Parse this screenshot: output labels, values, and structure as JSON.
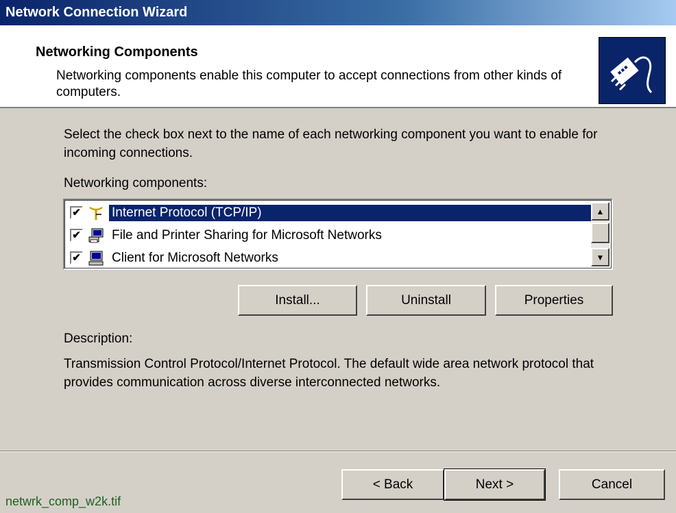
{
  "window": {
    "title": "Network Connection Wizard"
  },
  "header": {
    "title": "Networking Components",
    "subtitle": "Networking components enable this computer to accept connections from other kinds of computers.",
    "icon": "network-cable-icon"
  },
  "main": {
    "intro": "Select the check box next to the name of each networking component you want to enable for incoming connections.",
    "list_label": "Networking components:",
    "components": [
      {
        "label": "Internet Protocol (TCP/IP)",
        "checked": true,
        "selected": true,
        "icon": "protocol-icon"
      },
      {
        "label": "File and Printer Sharing for Microsoft Networks",
        "checked": true,
        "selected": false,
        "icon": "file-printer-sharing-icon"
      },
      {
        "label": "Client for Microsoft Networks",
        "checked": true,
        "selected": false,
        "icon": "network-client-icon"
      }
    ],
    "buttons": {
      "install": "Install...",
      "uninstall": "Uninstall",
      "properties": "Properties"
    },
    "description_label": "Description:",
    "description": "Transmission Control Protocol/Internet Protocol. The default wide area network protocol that provides communication across diverse interconnected networks."
  },
  "footer": {
    "back": "< Back",
    "next": "Next >",
    "cancel": "Cancel"
  },
  "caption": "netwrk_comp_w2k.tif",
  "colors": {
    "titlebar": "#0a246a",
    "selection": "#0a246a",
    "dialog": "#d4d0c8"
  }
}
